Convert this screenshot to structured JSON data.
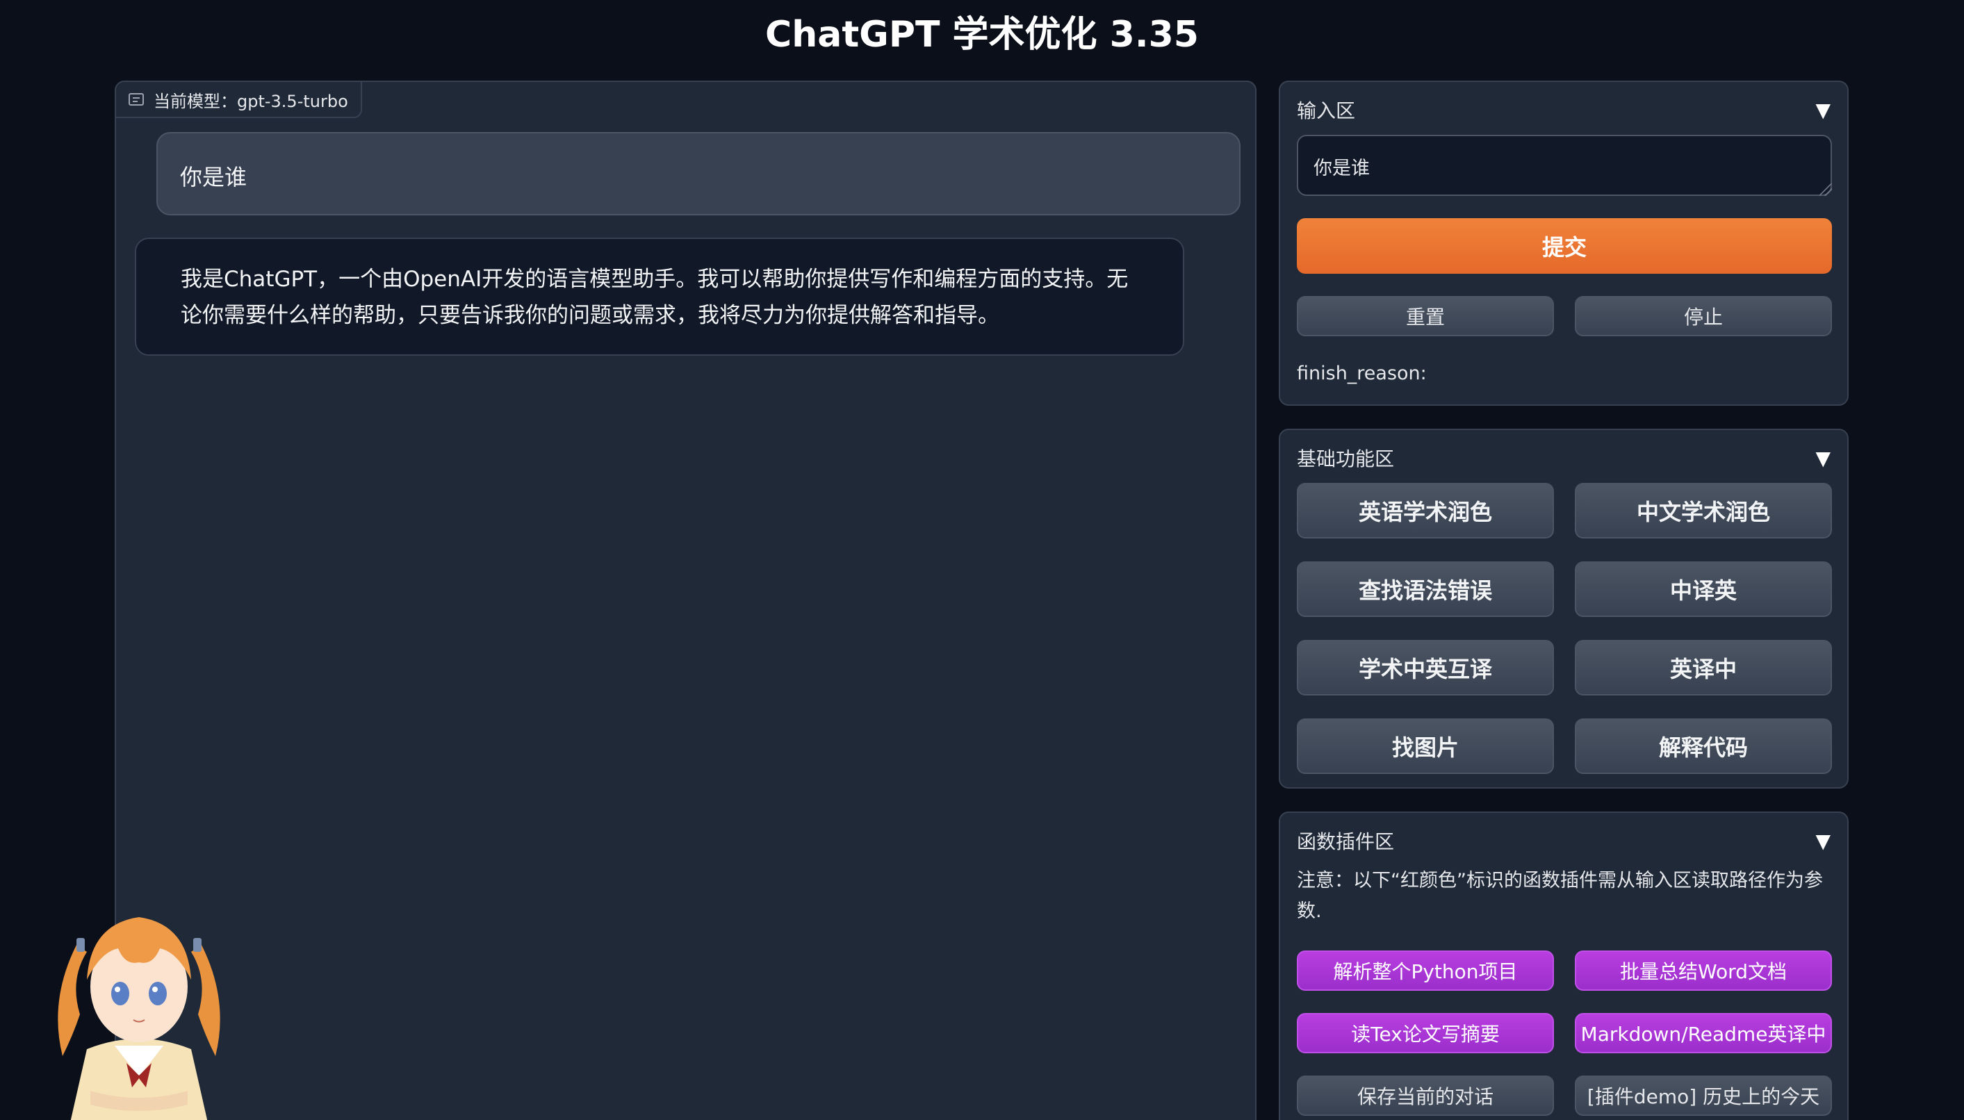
{
  "app": {
    "title": "ChatGPT 学术优化 3.35"
  },
  "chat": {
    "model_label": "当前模型：gpt-3.5-turbo",
    "messages": [
      {
        "role": "user",
        "text": "你是谁"
      },
      {
        "role": "assistant",
        "text": "我是ChatGPT，一个由OpenAI开发的语言模型助手。我可以帮助你提供写作和编程方面的支持。无论你需要什么样的帮助，只要告诉我你的问题或需求，我将尽力为你提供解答和指导。"
      }
    ]
  },
  "input_area": {
    "title": "输入区",
    "value": "你是谁",
    "submit_label": "提交",
    "reset_label": "重置",
    "stop_label": "停止",
    "finish_reason": "finish_reason:"
  },
  "basic_area": {
    "title": "基础功能区",
    "buttons": [
      "英语学术润色",
      "中文学术润色",
      "查找语法错误",
      "中译英",
      "学术中英互译",
      "英译中",
      "找图片",
      "解释代码"
    ]
  },
  "plugin_area": {
    "title": "函数插件区",
    "note": "注意：以下“红颜色”标识的函数插件需从输入区读取路径作为参数.",
    "buttons": [
      "解析整个Python项目",
      "批量总结Word文档",
      "读Tex论文写摘要",
      "Markdown/Readme英译中",
      "保存当前的对话",
      "[插件demo] 历史上的今天"
    ]
  },
  "icons": {
    "collapse": "collapse-triangle-icon",
    "chat": "chat-bubble-icon"
  },
  "colors": {
    "accent_orange": "#e87530",
    "plugin_purple": "#a832d6",
    "background": "#0b0f19",
    "panel": "#1f2937"
  }
}
